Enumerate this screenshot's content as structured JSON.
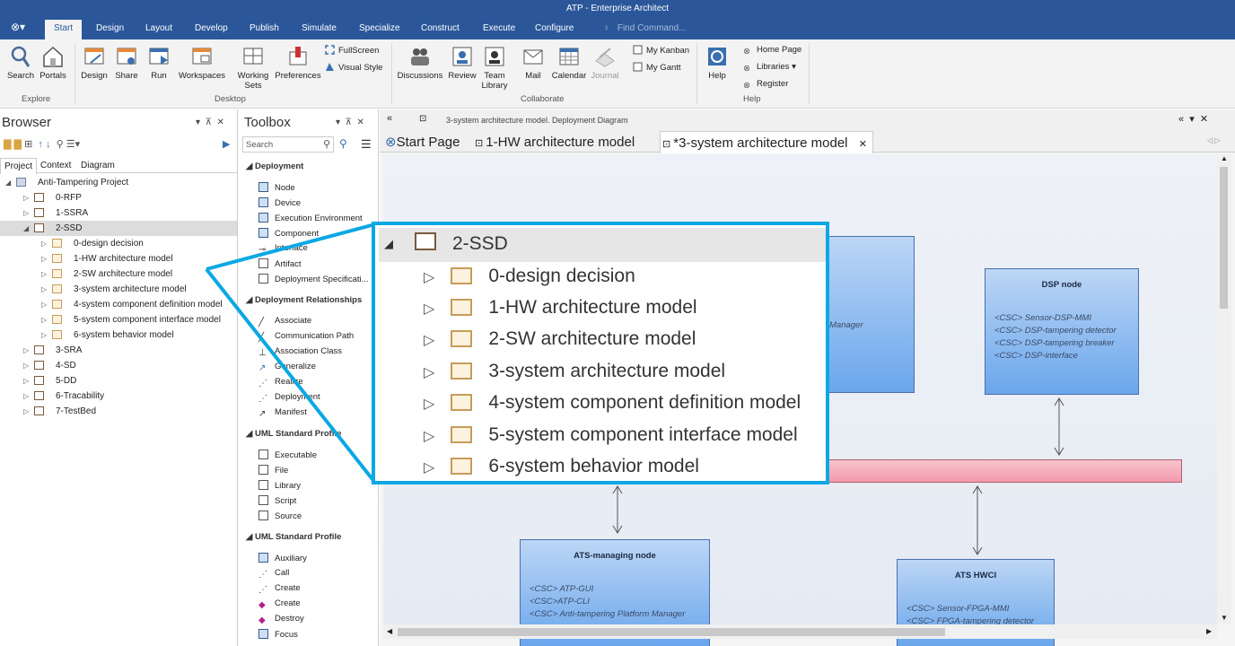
{
  "window": {
    "title": "ATP - Enterprise Architect"
  },
  "menu": {
    "tabs": [
      "Start",
      "Design",
      "Layout",
      "Develop",
      "Publish",
      "Simulate",
      "Specialize",
      "Construct",
      "Execute",
      "Configure"
    ],
    "active": "Start",
    "find_placeholder": "Find Command..."
  },
  "ribbon": {
    "explore": {
      "label": "Explore",
      "buttons": [
        "Search",
        "Portals"
      ]
    },
    "desktop": {
      "label": "Desktop",
      "buttons": [
        "Design",
        "Share",
        "Run",
        "Workspaces",
        "Working Sets",
        "Preferences"
      ],
      "small": [
        "FullScreen",
        "Visual Style"
      ]
    },
    "collaborate": {
      "label": "Collaborate",
      "buttons": [
        "Discussions",
        "Review",
        "Team Library",
        "Mail",
        "Calendar",
        "Journal"
      ],
      "small": [
        "My Kanban",
        "My Gantt"
      ]
    },
    "help": {
      "label": "Help",
      "buttons": [
        "Help"
      ],
      "small": [
        "Home Page",
        "Libraries",
        "Register"
      ]
    }
  },
  "browser": {
    "title": "Browser",
    "tabs": [
      "Project",
      "Context",
      "Diagram"
    ],
    "active_tab": "Project",
    "root": "Anti-Tampering Project",
    "items": [
      "0-RFP",
      "1-SSRA",
      "2-SSD",
      "3-SRA",
      "4-SD",
      "5-DD",
      "6-Tracability",
      "7-TestBed"
    ],
    "selected": "2-SSD",
    "children": [
      "0-design decision",
      "1-HW architecture model",
      "2-SW architecture model",
      "3-system architecture model",
      "4-system component definition model",
      "5-system component interface model",
      "6-system behavior model"
    ]
  },
  "toolbox": {
    "title": "Toolbox",
    "search_placeholder": "Search",
    "sections": [
      {
        "title": "Deployment",
        "items": [
          "Node",
          "Device",
          "Execution Environment",
          "Component",
          "Interface",
          "Artifact",
          "Deployment Specificati..."
        ]
      },
      {
        "title": "Deployment Relationships",
        "items": [
          "Associate",
          "Communication Path",
          "Association Class",
          "Generalize",
          "Realize",
          "Deployment",
          "Manifest"
        ]
      },
      {
        "title": "UML Standard Profile",
        "items": [
          "Executable",
          "File",
          "Library",
          "Script",
          "Source"
        ]
      },
      {
        "title": "UML Standard Profile",
        "items": [
          "Auxiliary",
          "Call",
          "Create",
          "Create",
          "Destroy",
          "Focus"
        ]
      }
    ]
  },
  "diagram": {
    "breadcrumb": "3-system architecture model.  Deployment Diagram",
    "tabs": [
      "Start Page",
      "1-HW architecture model",
      "*3-system architecture model"
    ],
    "active_tab": "*3-system architecture model",
    "nodes": [
      {
        "name": "DSP node",
        "classes": [
          "<CSC> Sensor-DSP-MMI",
          "<CSC> DSP-tampering detector",
          "<CSC> DSP-tampering breaker",
          "<CSC> DSP-interface"
        ]
      },
      {
        "name": "ATS-managing node",
        "classes": [
          "<CSC> ATP-GUI",
          "<CSC>ATP-CLI",
          "<CSC> Anti-tampering Platform Manager"
        ]
      },
      {
        "name": "ATS HWCI",
        "classes": [
          "<CSC> Sensor-FPGA-MMI",
          "<CSC> FPGA-tampering detector"
        ]
      }
    ],
    "partial_text": "Manager"
  },
  "zoom": {
    "header": "2-SSD"
  },
  "colors": {
    "accent": "#2b579a",
    "callout": "#0aa8e4",
    "bus": "#f4a0b0",
    "node": "#6aa6ec"
  }
}
